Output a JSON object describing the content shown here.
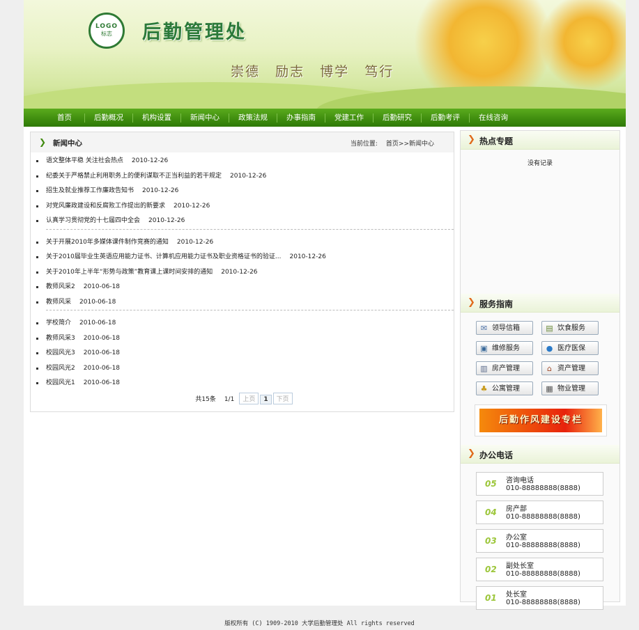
{
  "header": {
    "logo_text": "LOGO",
    "logo_sub": "标志",
    "site_title": "后勤管理处",
    "motto": [
      "崇德",
      "励志",
      "博学",
      "笃行"
    ]
  },
  "nav": [
    "首页",
    "后勤概况",
    "机构设置",
    "新闻中心",
    "政策法规",
    "办事指南",
    "党建工作",
    "后勤研究",
    "后勤考评",
    "在线咨询"
  ],
  "main": {
    "title": "新闻中心",
    "location_label": "当前位置:",
    "location_path": "首页>>新闻中心",
    "groups": [
      [
        {
          "title": "语文整体平稳 关注社会热点",
          "date": "2010-12-26"
        },
        {
          "title": "纪委关于严格禁止利用职务上的便利谋取不正当利益的若干规定",
          "date": "2010-12-26"
        },
        {
          "title": "招生及就业推荐工作廉政告知书",
          "date": "2010-12-26"
        },
        {
          "title": "对党风廉政建设和反腐败工作提出的新要求",
          "date": "2010-12-26"
        },
        {
          "title": "认真学习贯彻党的十七届四中全会",
          "date": "2010-12-26"
        }
      ],
      [
        {
          "title": "关于开展2010年多媒体课件制作竞赛的通知",
          "date": "2010-12-26"
        },
        {
          "title": "关于2010届毕业生英语应用能力证书、计算机应用能力证书及职业资格证书的验证...",
          "date": "2010-12-26"
        },
        {
          "title": "关于2010年上半年“形势与政策”教育课上课时间安排的通知",
          "date": "2010-12-26"
        },
        {
          "title": "教师风采2",
          "date": "2010-06-18"
        },
        {
          "title": "教师风采",
          "date": "2010-06-18"
        }
      ],
      [
        {
          "title": "学校简介",
          "date": "2010-06-18"
        },
        {
          "title": "教师风采3",
          "date": "2010-06-18"
        },
        {
          "title": "校园风光3",
          "date": "2010-06-18"
        },
        {
          "title": "校园风光2",
          "date": "2010-06-18"
        },
        {
          "title": "校园风光1",
          "date": "2010-06-18"
        }
      ]
    ],
    "pager": {
      "total": "共15条",
      "pages": "1/1",
      "prev": "上页",
      "current": "1",
      "next": "下页"
    }
  },
  "side": {
    "hot_title": "热点专题",
    "no_record": "没有记录",
    "service_title": "服务指南",
    "services": [
      {
        "label": "领导信箱",
        "icon": "mailbox-icon",
        "glyph": "✉"
      },
      {
        "label": "饮食服务",
        "icon": "food-icon",
        "glyph": "▤"
      },
      {
        "label": "维修服务",
        "icon": "monitor-icon",
        "glyph": "▣"
      },
      {
        "label": "医疗医保",
        "icon": "globe-icon",
        "glyph": "●"
      },
      {
        "label": "房产管理",
        "icon": "building-icon",
        "glyph": "▥"
      },
      {
        "label": "资产管理",
        "icon": "house-icon",
        "glyph": "⌂"
      },
      {
        "label": "公寓管理",
        "icon": "bell-icon",
        "glyph": "♣"
      },
      {
        "label": "物业管理",
        "icon": "document-icon",
        "glyph": "▦"
      }
    ],
    "promo_text": "后勤作风建设专栏",
    "phone_title": "办公电话",
    "phones": [
      {
        "num": "05",
        "name": "咨询电话",
        "tel": "010-88888888(8888)"
      },
      {
        "num": "04",
        "name": "房产部",
        "tel": "010-88888888(8888)"
      },
      {
        "num": "03",
        "name": "办公室",
        "tel": "010-88888888(8888)"
      },
      {
        "num": "02",
        "name": "副处长室",
        "tel": "010-88888888(8888)"
      },
      {
        "num": "01",
        "name": "处长室",
        "tel": "010-88888888(8888)"
      }
    ]
  },
  "footer": "版权所有 (C)  1909-2010  大学后勤管理处 All rights reserved",
  "colors": {
    "nav_green": "#3e8c0e",
    "accent_orange": "#e06a1a",
    "phone_num": "#9cc63a"
  }
}
